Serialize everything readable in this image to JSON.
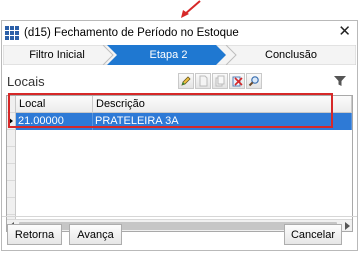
{
  "window": {
    "title": "(d15) Fechamento de Período no Estoque",
    "close_glyph": "✕"
  },
  "wizard": {
    "steps": [
      {
        "label": "Filtro Inicial",
        "active": false
      },
      {
        "label": "Etapa 2",
        "active": true
      },
      {
        "label": "Conclusão",
        "active": false
      }
    ],
    "active_color": "#1f78d1"
  },
  "section": {
    "title": "Locais"
  },
  "toolbar": {
    "icons": [
      "edit-icon",
      "new-icon",
      "copy-icon",
      "delete-icon",
      "search-icon"
    ],
    "filter_icon": "filter-icon"
  },
  "grid": {
    "columns": [
      "Local",
      "Descrição"
    ],
    "rows": [
      {
        "local": "21.00000",
        "descricao": "PRATELEIRA 3A",
        "selected": true
      }
    ],
    "selection_color": "#2e7ad6"
  },
  "highlight_color": "#d62828",
  "buttons": {
    "back": "Retorna",
    "next": "Avança",
    "cancel": "Cancelar"
  }
}
